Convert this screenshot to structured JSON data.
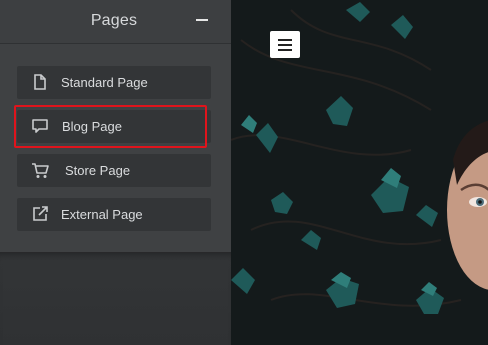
{
  "panel": {
    "title": "Pages",
    "items": [
      {
        "label": "Standard Page",
        "icon": "document-icon"
      },
      {
        "label": "Blog Page",
        "icon": "comment-icon"
      },
      {
        "label": "Store Page",
        "icon": "cart-icon"
      },
      {
        "label": "External Page",
        "icon": "external-link-icon"
      }
    ]
  },
  "colors": {
    "panel_bg": "#3f4143",
    "item_bg": "#333537",
    "highlight": "#e0141c"
  },
  "hero": {
    "description_icons": [
      "menu-icon"
    ]
  }
}
